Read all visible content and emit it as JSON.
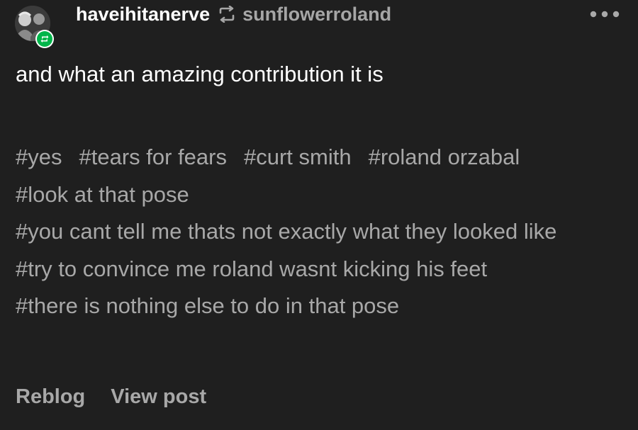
{
  "post": {
    "blog_name": "haveihitanerve",
    "source_name": "sunflowerroland",
    "body_text": "and what an amazing contribution it is",
    "tags_inline": [
      "#yes",
      "#tears for fears",
      "#curt smith",
      "#roland orzabal"
    ],
    "tags_block": [
      "#look at that pose",
      "#you cant tell me thats not exactly what they looked like",
      "#try to convince me roland wasnt kicking his feet",
      "#there is nothing else to do in that pose"
    ],
    "actions": {
      "reblog": "Reblog",
      "view_post": "View post"
    }
  },
  "colors": {
    "background": "#1f1f1f",
    "text_primary": "#ffffff",
    "text_secondary": "#a8a8a8",
    "reblog_badge": "#00b54a"
  },
  "icons": {
    "reblog_arrow": "reblog-icon",
    "more": "more-options-icon",
    "badge": "reblog-badge-icon"
  }
}
